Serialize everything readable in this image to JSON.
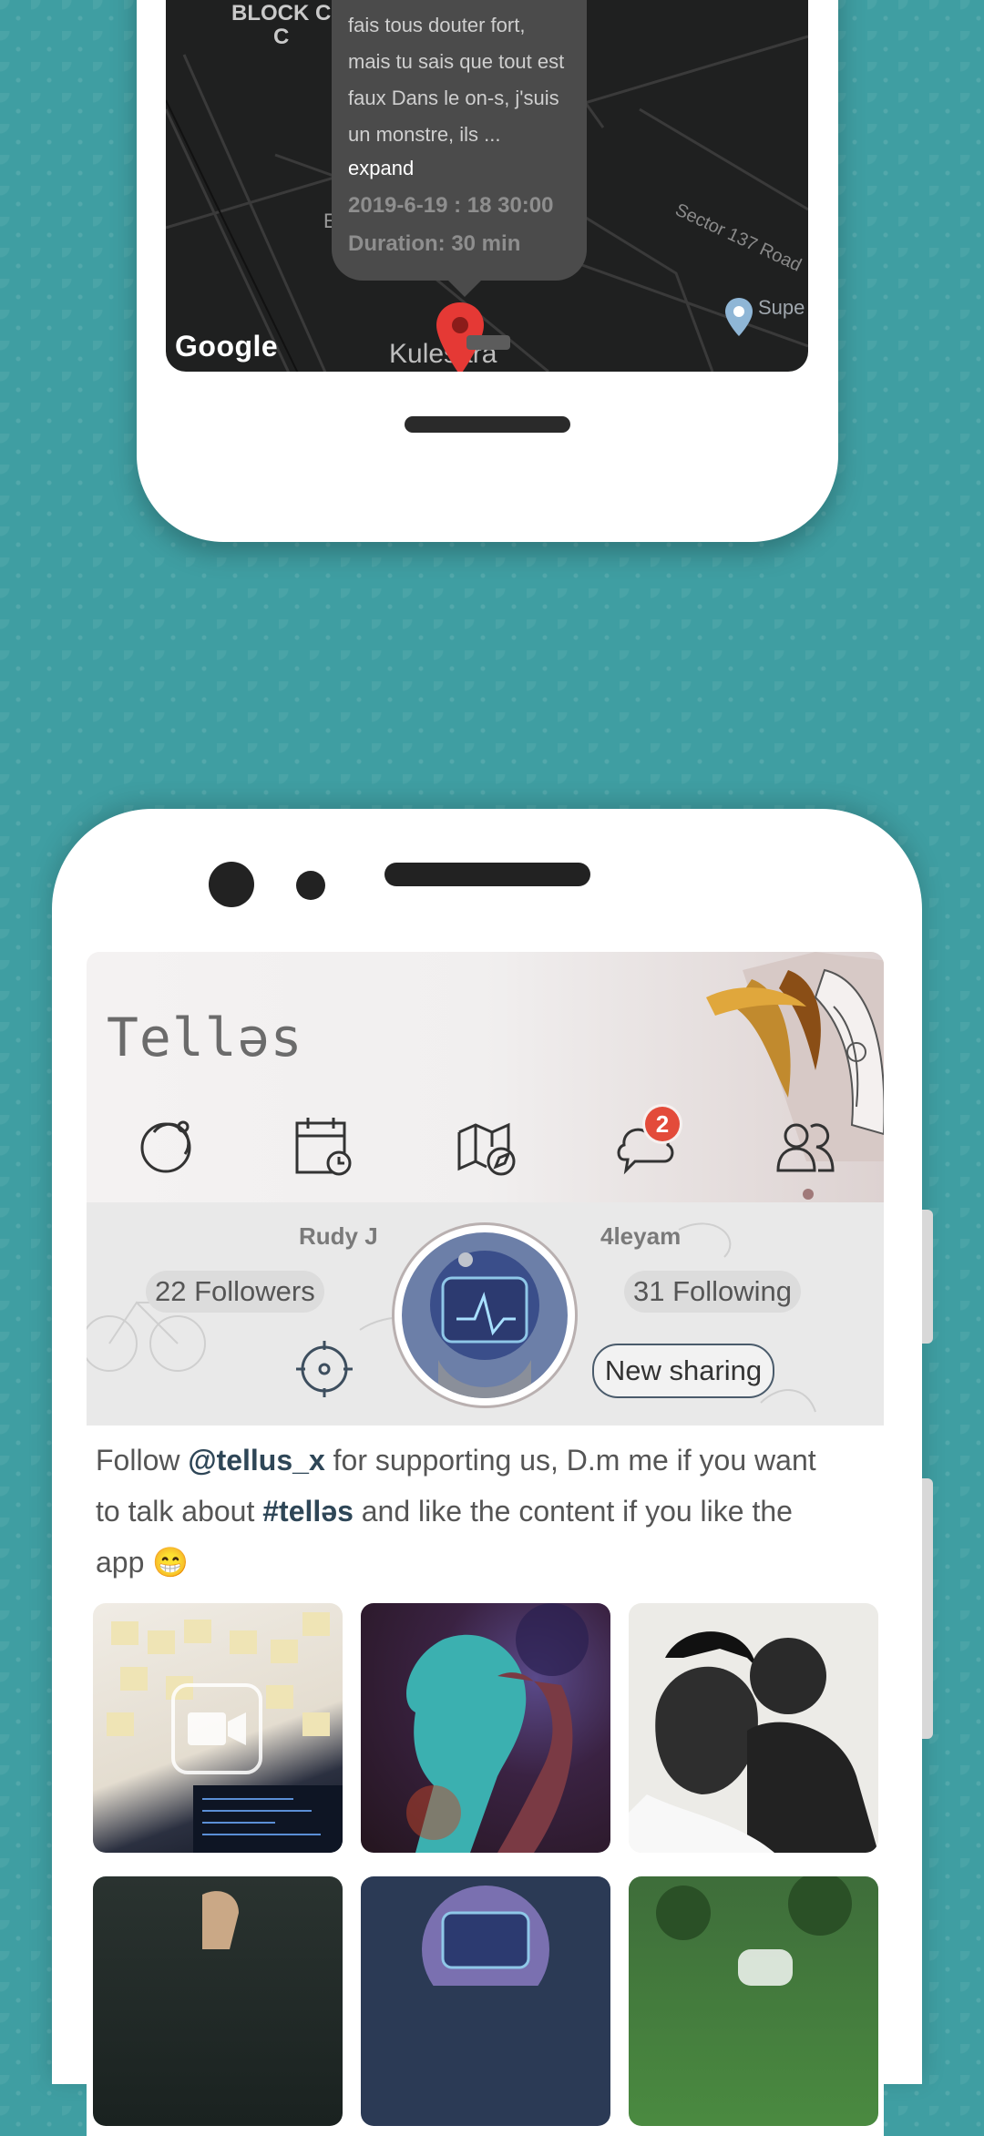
{
  "map": {
    "labels": {
      "block": "BLOCK C\nC",
      "road": "Sector 137 Road",
      "super": "Supe",
      "kule": "Kulesara",
      "b": "E"
    },
    "popup": {
      "text": "fais tous douter fort, mais tu sais que tout est faux Dans le on-s, j'suis un monstre, ils ...",
      "expand": "expand",
      "date": "2019-6-19 : 18 30:00",
      "duration": "Duration: 30 min"
    },
    "google": "Google"
  },
  "app": {
    "brand": "Telləs",
    "nav": {
      "icons": [
        "planet-icon",
        "calendar-clock-icon",
        "map-compass-icon",
        "chat-cloud-icon",
        "people-icon"
      ],
      "chat_badge": "2"
    }
  },
  "profile": {
    "left_user": "Rudy J",
    "right_user": "4leyam",
    "followers": "22 Followers",
    "following": "31 Following",
    "new_sharing": "New sharing"
  },
  "bio": {
    "t1": "Follow ",
    "mention": "@tellus_x",
    "t2": " for supporting us, D.m me if you want to talk about ",
    "hashtag": "#telləs",
    "t3": " and like the content if you like the app 😁"
  },
  "colors": {
    "background": "#3f9ea2",
    "badge": "#e34b3a",
    "accent_text": "#2e4657"
  }
}
